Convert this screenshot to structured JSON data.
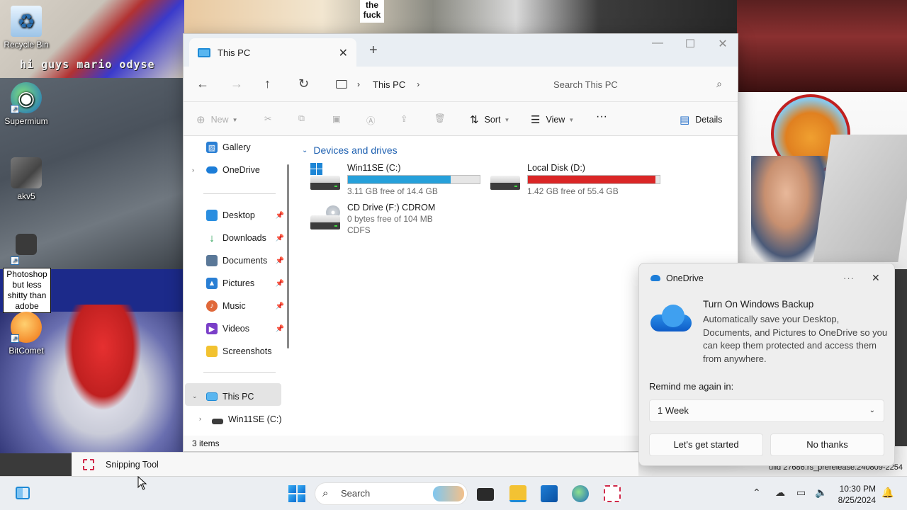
{
  "desktop": {
    "icons": [
      {
        "label": "Recycle Bin"
      },
      {
        "label": "Supermium"
      },
      {
        "label": "akv5"
      },
      {
        "label": "Photoshop but less shitty than adobe"
      },
      {
        "label": "BitComet"
      }
    ],
    "wallpaper_text": {
      "graffiti": "hi guys mario odyse",
      "sign": "the fuck",
      "build": "uild 27686.rs_prerelease.240809-2254"
    }
  },
  "explorer": {
    "tab_title": "This PC",
    "breadcrumb": [
      "This PC"
    ],
    "search_placeholder": "Search This PC",
    "commands": {
      "new": "New",
      "sort": "Sort",
      "view": "View",
      "more": "···",
      "details": "Details"
    },
    "sidebar": {
      "items": [
        {
          "label": "Gallery",
          "icon": "gallery-icon"
        },
        {
          "label": "OneDrive",
          "icon": "onedrive-icon"
        },
        {
          "label": "Desktop",
          "icon": "desktop-folder-icon"
        },
        {
          "label": "Downloads",
          "icon": "downloads-icon"
        },
        {
          "label": "Documents",
          "icon": "documents-icon"
        },
        {
          "label": "Pictures",
          "icon": "pictures-icon"
        },
        {
          "label": "Music",
          "icon": "music-icon"
        },
        {
          "label": "Videos",
          "icon": "videos-icon"
        },
        {
          "label": "Screenshots",
          "icon": "folder-icon"
        },
        {
          "label": "This PC",
          "icon": "this-pc-icon"
        },
        {
          "label": "Win11SE (C:)",
          "icon": "drive-icon"
        }
      ]
    },
    "group_header": "Devices and drives",
    "drives": [
      {
        "name": "Win11SE (C:)",
        "free": "3.11 GB free of 14.4 GB",
        "used_fraction": 0.78,
        "bar_color": "#26a0da"
      },
      {
        "name": "Local Disk (D:)",
        "free": "1.42 GB free of 55.4 GB",
        "used_fraction": 0.97,
        "bar_color": "#da2626"
      },
      {
        "name": "CD Drive (F:) CDROM",
        "free": "0 bytes free of 104 MB",
        "filesystem": "CDFS"
      }
    ],
    "status": "3 items"
  },
  "toast": {
    "app_name": "OneDrive",
    "more": "···",
    "title": "Turn On Windows Backup",
    "message": "Automatically save your Desktop, Documents, and Pictures to OneDrive so you can keep them protected and access them from anywhere.",
    "remind_label": "Remind me again in:",
    "remind_value": "1 Week",
    "primary_button": "Let's get started",
    "secondary_button": "No thanks"
  },
  "snipping": {
    "label": "Snipping Tool"
  },
  "taskbar": {
    "search_label": "Search",
    "time": "10:30 PM",
    "date": "8/25/2024"
  },
  "colors": {
    "accent": "#1e8ad6",
    "drive_ok": "#26a0da",
    "drive_full": "#da2626"
  }
}
